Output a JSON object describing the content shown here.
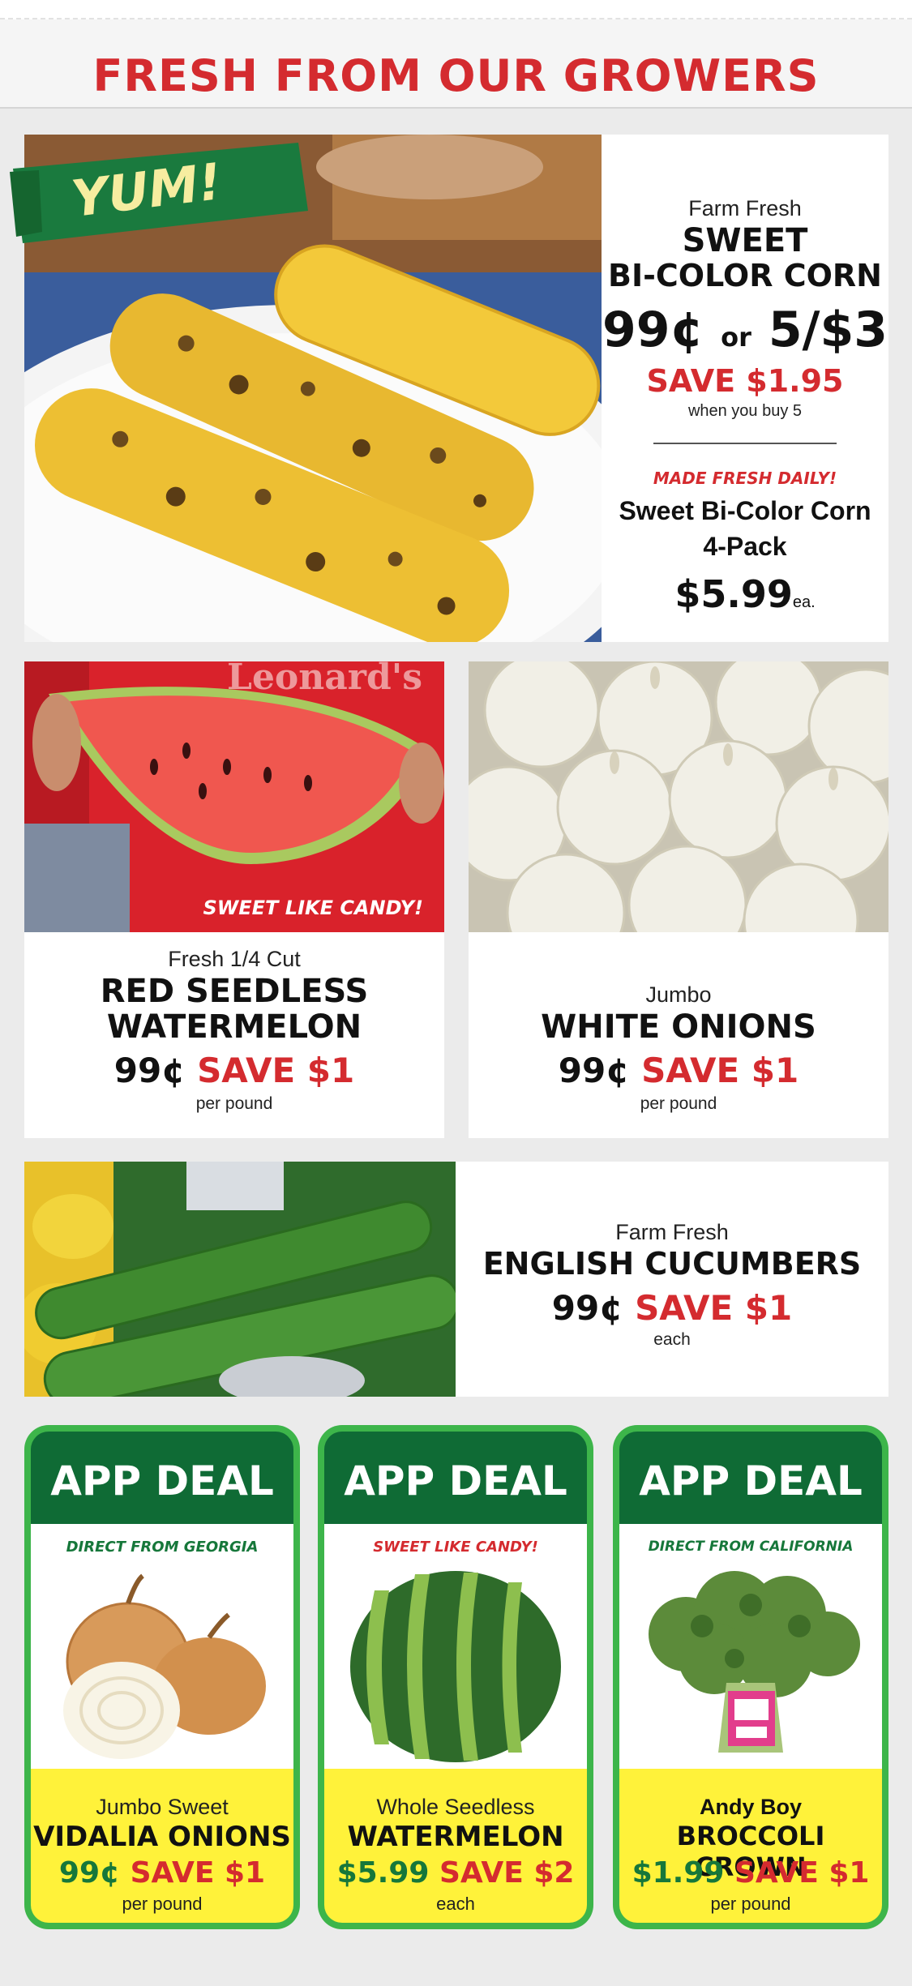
{
  "header": {
    "title": "FRESH FROM OUR GROWERS"
  },
  "corn": {
    "badge": "YUM!",
    "kicker": "Farm Fresh",
    "name_line1": "SWEET",
    "name_line2": "BI-COLOR CORN",
    "price_single": "99¢",
    "price_or": "or",
    "price_multi": "5/$3",
    "save": "SAVE $1.95",
    "save_note": "when you buy 5",
    "made_fresh": "MADE FRESH DAILY!",
    "pack_line1": "Sweet Bi-Color Corn",
    "pack_line2": "4-Pack",
    "pack_price": "$5.99",
    "pack_unit": "ea."
  },
  "watermelon_cut": {
    "photo_caption": "SWEET LIKE CANDY!",
    "shirt_text": "Leonard's",
    "kicker": "Fresh 1/4 Cut",
    "name_line1": "RED SEEDLESS",
    "name_line2": "WATERMELON",
    "price": "99¢",
    "save": "SAVE $1",
    "unit": "per pound"
  },
  "onions_white": {
    "kicker": "Jumbo",
    "name": "WHITE ONIONS",
    "price": "99¢",
    "save": "SAVE $1",
    "unit": "per pound"
  },
  "cucumbers": {
    "kicker": "Farm Fresh",
    "name": "ENGLISH CUCUMBERS",
    "price": "99¢",
    "save": "SAVE $1",
    "unit": "each"
  },
  "app_deals": [
    {
      "header": "APP DEAL",
      "tagline": "DIRECT FROM GEORGIA",
      "kicker": "Jumbo Sweet",
      "name": "VIDALIA ONIONS",
      "price": "99¢",
      "save": "SAVE $1",
      "unit": "per pound"
    },
    {
      "header": "APP DEAL",
      "tagline": "SWEET LIKE CANDY!",
      "kicker": "Whole Seedless",
      "name": "WATERMELON",
      "price": "$5.99",
      "save": "SAVE $2",
      "unit": "each"
    },
    {
      "header": "APP DEAL",
      "tagline": "DIRECT FROM CALIFORNIA",
      "kicker": "Andy Boy",
      "name": "BROCCOLI CROWN",
      "price": "$1.99",
      "save": "SAVE $1",
      "unit": "per pound"
    }
  ],
  "colors": {
    "title_red": "#d42b2f",
    "deal_green": "#16773a",
    "card_green": "#3db54a",
    "card_dark_green": "#0f6b35",
    "card_yellow": "#fff23a",
    "page_gray": "#ebebeb"
  }
}
